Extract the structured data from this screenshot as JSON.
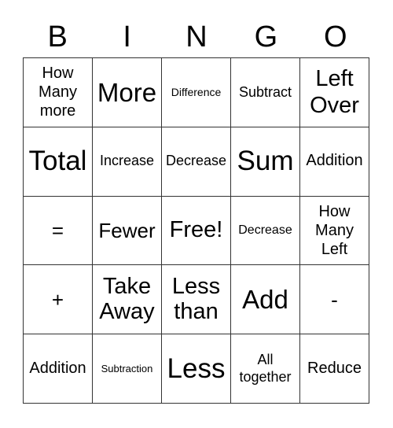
{
  "header": [
    "B",
    "I",
    "N",
    "G",
    "O"
  ],
  "cells": [
    [
      "How Many more",
      "More",
      "Difference",
      "Subtract",
      "Left Over"
    ],
    [
      "Total",
      "Increase",
      "Decrease",
      "Sum",
      "Addition"
    ],
    [
      "=",
      "Fewer",
      "Free!",
      "Decrease",
      "How Many Left"
    ],
    [
      "+",
      "Take Away",
      "Less than",
      "Add",
      "-"
    ],
    [
      "Addition",
      "Subtraction",
      "Less",
      "All together",
      "Reduce"
    ]
  ]
}
